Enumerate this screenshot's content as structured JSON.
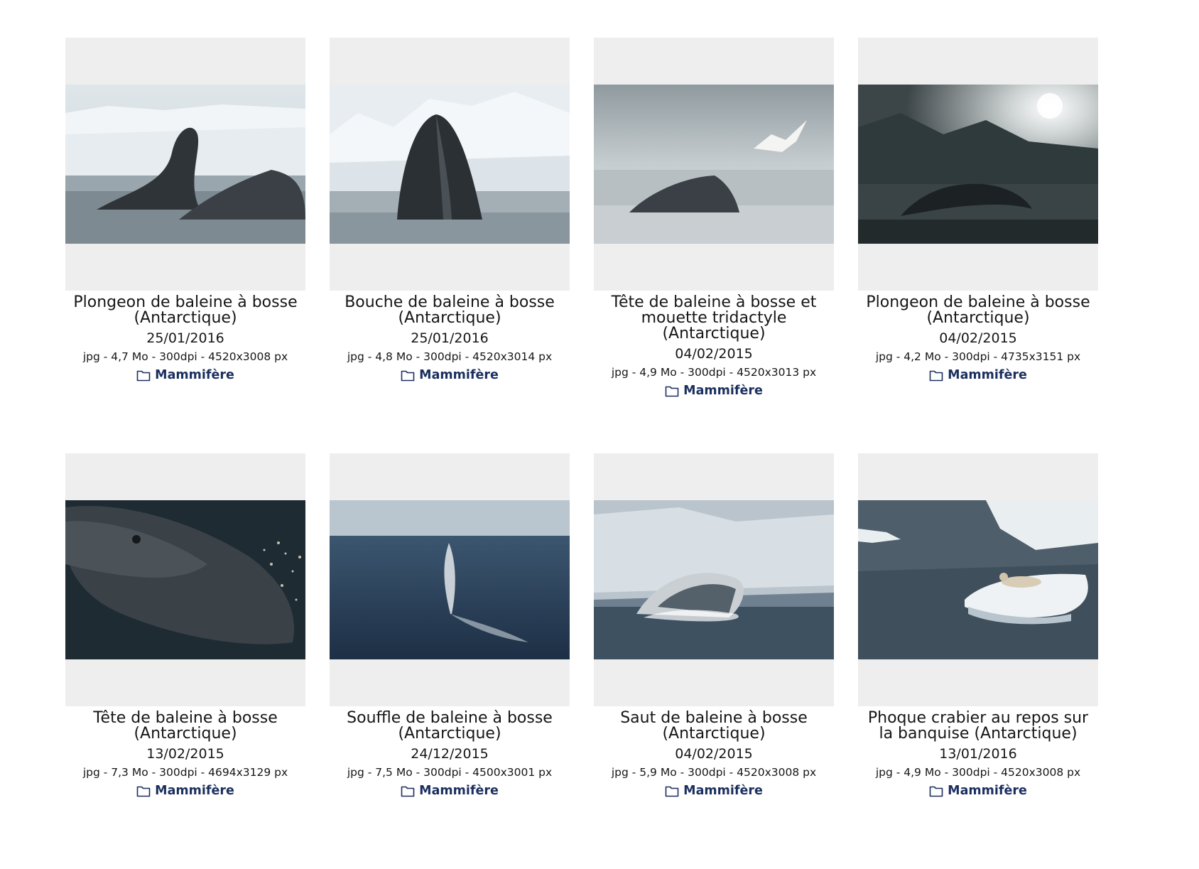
{
  "category_color": "#1b2f5f",
  "cards": [
    {
      "title": "Plongeon de baleine à bosse (Antarctique)",
      "date": "25/01/2016",
      "meta": "jpg - 4,7 Mo - 300dpi - 4520x3008 px",
      "category": "Mammifère",
      "icon": "folder-icon"
    },
    {
      "title": "Bouche de baleine à bosse (Antarctique)",
      "date": "25/01/2016",
      "meta": "jpg - 4,8 Mo - 300dpi - 4520x3014 px",
      "category": "Mammifère",
      "icon": "folder-icon"
    },
    {
      "title": "Tête de baleine à bosse et mouette tridactyle (Antarctique)",
      "date": "04/02/2015",
      "meta": "jpg - 4,9 Mo - 300dpi - 4520x3013 px",
      "category": "Mammifère",
      "icon": "folder-icon"
    },
    {
      "title": "Plongeon de baleine à bosse (Antarctique)",
      "date": "04/02/2015",
      "meta": "jpg - 4,2 Mo - 300dpi - 4735x3151 px",
      "category": "Mammifère",
      "icon": "folder-icon"
    },
    {
      "title": "Tête de baleine à bosse (Antarctique)",
      "date": "13/02/2015",
      "meta": "jpg - 7,3 Mo - 300dpi - 4694x3129 px",
      "category": "Mammifère",
      "icon": "folder-icon"
    },
    {
      "title": "Souffle de baleine à bosse (Antarctique)",
      "date": "24/12/2015",
      "meta": "jpg - 7,5 Mo - 300dpi - 4500x3001 px",
      "category": "Mammifère",
      "icon": "folder-icon"
    },
    {
      "title": "Saut de baleine à bosse (Antarctique)",
      "date": "04/02/2015",
      "meta": "jpg - 5,9 Mo - 300dpi - 4520x3008 px",
      "category": "Mammifère",
      "icon": "folder-icon"
    },
    {
      "title": "Phoque crabier au repos sur la banquise (Antarctique)",
      "date": "13/01/2016",
      "meta": "jpg - 4,9 Mo - 300dpi - 4520x3008 px",
      "category": "Mammifère",
      "icon": "folder-icon"
    }
  ]
}
